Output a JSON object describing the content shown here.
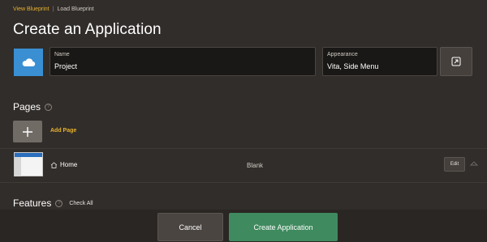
{
  "breadcrumb": {
    "link": "View Blueprint",
    "current": "Load Blueprint"
  },
  "title": "Create an Application",
  "app_icon": {
    "icon": "cloud-icon",
    "color": "#3a8fd3"
  },
  "name_field": {
    "label": "Name",
    "value": "Project"
  },
  "appearance_field": {
    "label": "Appearance",
    "value": "Vita, Side Menu"
  },
  "pages": {
    "title": "Pages",
    "add_label": "Add Page",
    "rows": [
      {
        "name": "Home",
        "type": "Blank",
        "edit_label": "Edit"
      }
    ]
  },
  "features": {
    "title": "Features",
    "check_all": "Check All"
  },
  "footer": {
    "cancel": "Cancel",
    "create": "Create Application"
  },
  "colors": {
    "accent": "#e8b22d",
    "primary": "#3f8a5e",
    "background": "#312d2a"
  }
}
